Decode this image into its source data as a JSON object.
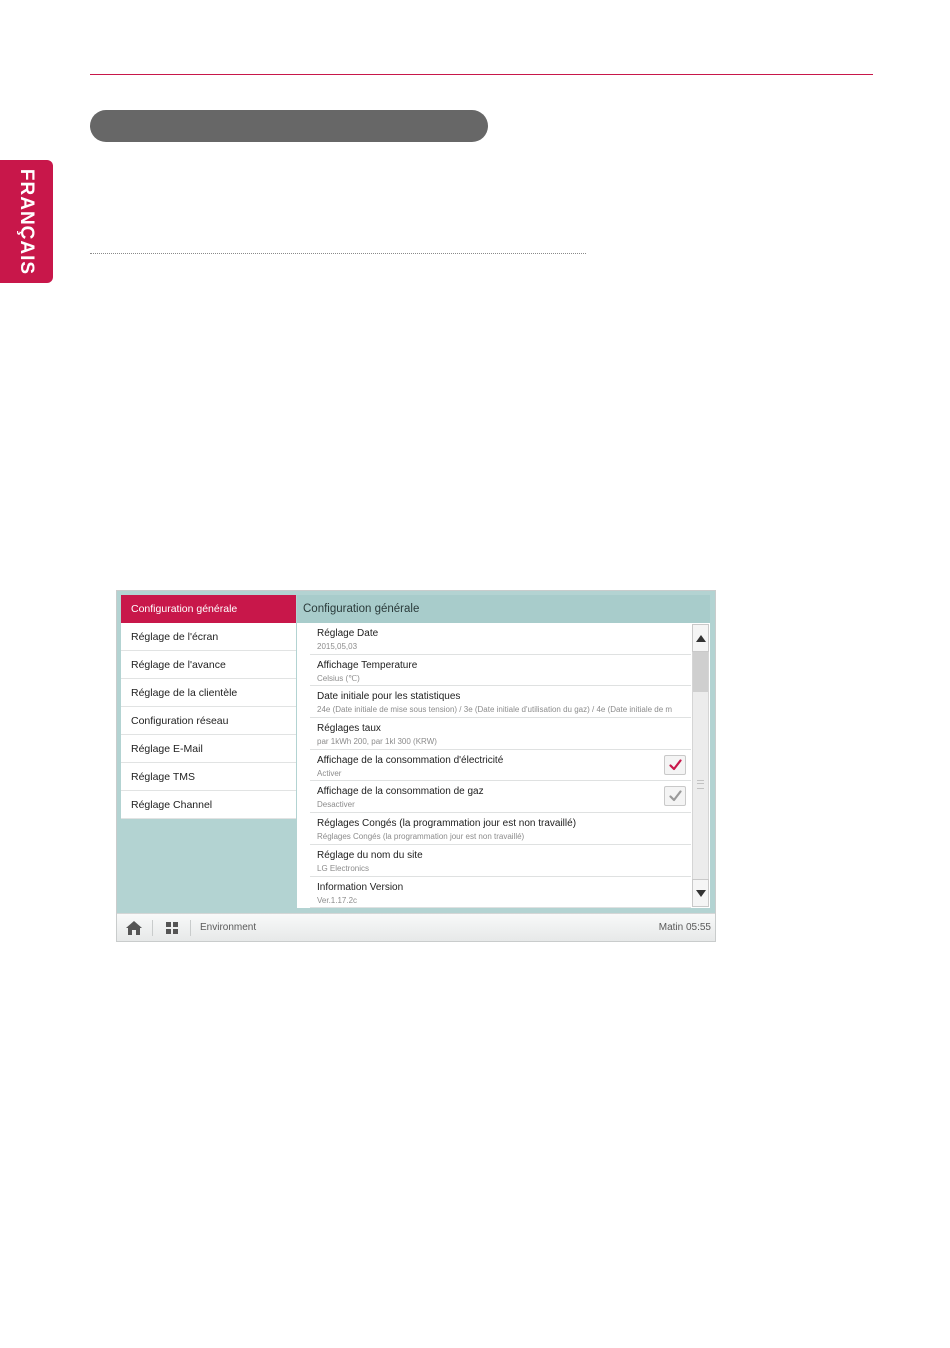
{
  "side_tab": {
    "language": "FRANÇAIS"
  },
  "sidebar": {
    "items": [
      {
        "label": "Configuration générale"
      },
      {
        "label": "Réglage de l'écran"
      },
      {
        "label": "Réglage de l'avance"
      },
      {
        "label": "Réglage de la clientèle"
      },
      {
        "label": "Configuration réseau"
      },
      {
        "label": "Réglage E-Mail"
      },
      {
        "label": "Réglage TMS"
      },
      {
        "label": "Réglage Channel"
      }
    ]
  },
  "panel": {
    "title": "Configuration générale",
    "rows": [
      {
        "title": "Réglage Date",
        "value": "2015,05,03"
      },
      {
        "title": "Affichage Temperature",
        "value": "Celsius (℃)"
      },
      {
        "title": "Date initiale pour les statistiques",
        "value": "24e (Date initiale de mise sous tension) / 3e (Date initiale d'utilisation du gaz) / 4e (Date initiale de m"
      },
      {
        "title": "Réglages taux",
        "value": "par 1kWh 200, par 1kl 300 (KRW)"
      },
      {
        "title": "Affichage de la consommation d'électricité",
        "value": "Activer",
        "checked": true
      },
      {
        "title": "Affichage de la consommation de gaz",
        "value": "Desactiver",
        "checked": false
      },
      {
        "title": "Réglages Congés (la programmation jour est non travaillé)",
        "value": "Réglages Congés (la programmation jour est non travaillé)"
      },
      {
        "title": "Réglage du nom du site",
        "value": "LG Electronics"
      },
      {
        "title": "Information Version",
        "value": "Ver.1.17.2c"
      }
    ]
  },
  "bottombar": {
    "breadcrumb": "Environment",
    "time": "Matin 05:55"
  },
  "colors": {
    "accent": "#c8174a",
    "panel_bg": "#b3d3d2",
    "header_bg": "#a8cccb"
  }
}
